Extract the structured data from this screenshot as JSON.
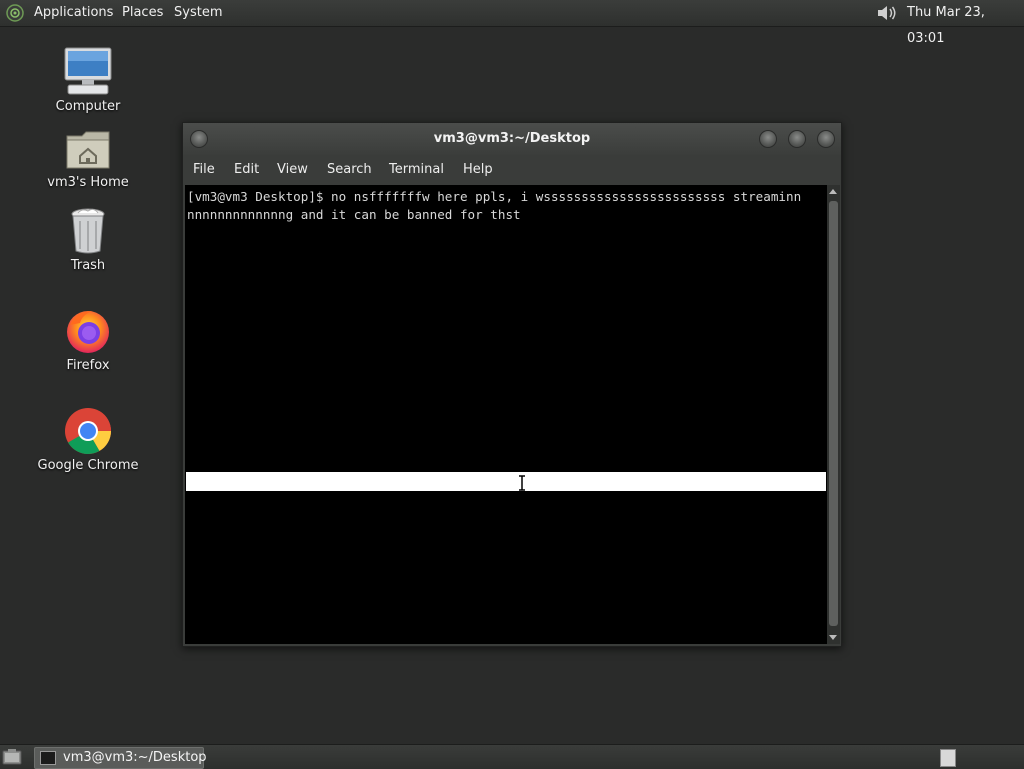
{
  "top_panel": {
    "menus": [
      "Applications",
      "Places",
      "System"
    ],
    "clock": "Thu Mar 23, 03:01"
  },
  "desktop_icons": [
    {
      "label": "Computer",
      "icon": "computer-icon"
    },
    {
      "label": "vm3's Home",
      "icon": "home-folder-icon"
    },
    {
      "label": "Trash",
      "icon": "trash-icon"
    },
    {
      "label": "Firefox",
      "icon": "firefox-icon"
    },
    {
      "label": "Google Chrome",
      "icon": "chrome-icon"
    }
  ],
  "terminal": {
    "title": "vm3@vm3:~/Desktop",
    "menu": [
      "File",
      "Edit",
      "View",
      "Search",
      "Terminal",
      "Help"
    ],
    "lines": [
      "[vm3@vm3 Desktop]$ no nsfffffffw here ppls, i wssssssssssssssssssssssss streaminn",
      "nnnnnnnnnnnnng and it can be banned for thst"
    ]
  },
  "taskbar": {
    "items": [
      {
        "label": "vm3@vm3:~/Desktop"
      }
    ]
  },
  "colors": {
    "desktop_bg": "#2a2b2a",
    "terminal_bg": "#000000",
    "terminal_fg": "#d8d8d8",
    "panel_bg": "#333533"
  }
}
